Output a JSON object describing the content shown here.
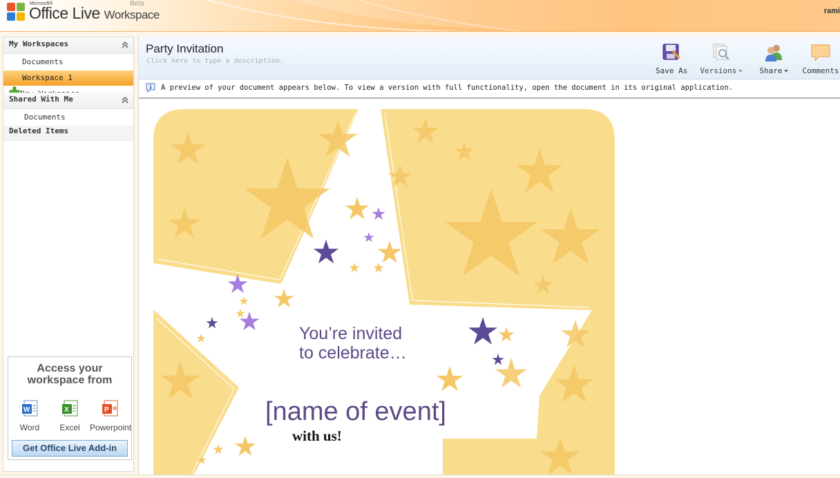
{
  "app": {
    "brand_small": "Microsoft®",
    "brand_main": "Office Live",
    "brand_product": "Workspace",
    "beta": "Beta",
    "user": "rami"
  },
  "sidebar": {
    "my_workspaces": {
      "title": "My Workspaces",
      "items": [
        {
          "label": "Documents"
        },
        {
          "label": "Workspace 1",
          "selected": true
        }
      ],
      "new_workspace": "New Workspace"
    },
    "shared_with_me": {
      "title": "Shared With Me",
      "items": [
        {
          "label": "Documents"
        }
      ]
    },
    "deleted_items": "Deleted Items",
    "access": {
      "title_line1": "Access your",
      "title_line2": "workspace from",
      "apps": [
        {
          "label": "Word",
          "icon": "word-icon"
        },
        {
          "label": "Excel",
          "icon": "excel-icon"
        },
        {
          "label": "Powerpoint",
          "icon": "powerpoint-icon"
        }
      ],
      "addin_button": "Get Office Live Add-in"
    }
  },
  "document": {
    "title": "Party Invitation",
    "description_placeholder": "Click here to type a description.",
    "toolbar": {
      "save_as": "Save As",
      "versions": "Versions",
      "share": "Share",
      "comments": "Comments"
    },
    "info": "A preview of your document appears below. To view a version with full functionality, open the document in its original application.",
    "preview": {
      "line1": "You’re invited",
      "line2": "to celebrate…",
      "event": "[name of event]",
      "with_us": "with us!"
    }
  },
  "colors": {
    "accent_orange": "#f6a12a",
    "star_gold": "#f5c766",
    "panel_gold": "#f9dc8c",
    "star_purple": "#5d4a96",
    "star_lilac": "#a77ee0",
    "text_purple": "#5d4a86"
  }
}
